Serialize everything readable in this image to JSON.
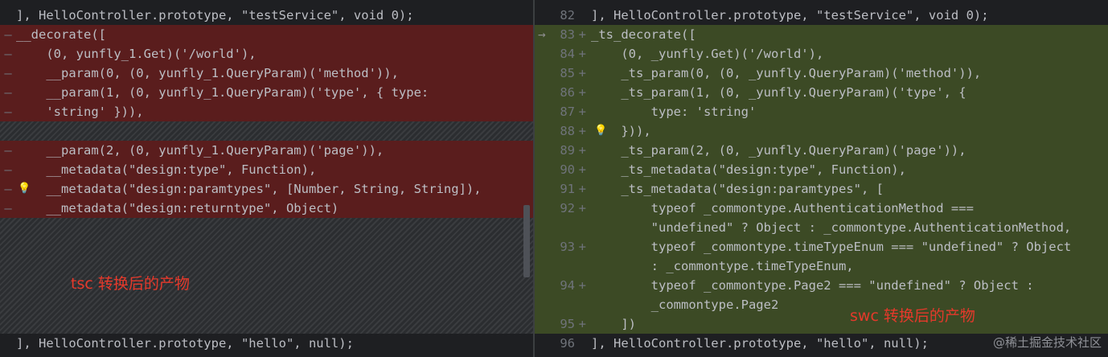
{
  "left": {
    "lines": [
      "], HelloController.prototype, \"testService\", void 0);",
      "__decorate([",
      "    (0, yunfly_1.Get)('/world'),",
      "    __param(0, (0, yunfly_1.QueryParam)('method')),",
      "    __param(1, (0, yunfly_1.QueryParam)('type', { type:",
      "    'string' })),",
      "    __param(2, (0, yunfly_1.QueryParam)('page')),",
      "    __metadata(\"design:type\", Function),",
      "    __metadata(\"design:paramtypes\", [Number, String, String]),",
      "    __metadata(\"design:returntype\", Object)",
      "], HelloController.prototype, \"hello\", null);"
    ],
    "annotation": "tsc 转换后的产物"
  },
  "right": {
    "lines": [
      {
        "no": "82",
        "mark": "",
        "text": "], HelloController.prototype, \"testService\", void 0);"
      },
      {
        "no": "83",
        "mark": "+",
        "text": "_ts_decorate(["
      },
      {
        "no": "84",
        "mark": "+",
        "text": "    (0, _yunfly.Get)('/world'),"
      },
      {
        "no": "85",
        "mark": "+",
        "text": "    _ts_param(0, (0, _yunfly.QueryParam)('method')),"
      },
      {
        "no": "86",
        "mark": "+",
        "text": "    _ts_param(1, (0, _yunfly.QueryParam)('type', {"
      },
      {
        "no": "87",
        "mark": "+",
        "text": "        type: 'string'"
      },
      {
        "no": "88",
        "mark": "+",
        "text": "    })),"
      },
      {
        "no": "89",
        "mark": "+",
        "text": "    _ts_param(2, (0, _yunfly.QueryParam)('page')),"
      },
      {
        "no": "90",
        "mark": "+",
        "text": "    _ts_metadata(\"design:type\", Function),"
      },
      {
        "no": "91",
        "mark": "+",
        "text": "    _ts_metadata(\"design:paramtypes\", ["
      },
      {
        "no": "92",
        "mark": "+",
        "text": "        typeof _commontype.AuthenticationMethod ==="
      },
      {
        "no": "",
        "mark": "",
        "text": "        \"undefined\" ? Object : _commontype.AuthenticationMethod,"
      },
      {
        "no": "93",
        "mark": "+",
        "text": "        typeof _commontype.timeTypeEnum === \"undefined\" ? Object"
      },
      {
        "no": "",
        "mark": "",
        "text": "        : _commontype.timeTypeEnum,"
      },
      {
        "no": "94",
        "mark": "+",
        "text": "        typeof _commontype.Page2 === \"undefined\" ? Object :"
      },
      {
        "no": "",
        "mark": "",
        "text": "        _commontype.Page2"
      },
      {
        "no": "95",
        "mark": "+",
        "text": "    ])"
      },
      {
        "no": "96",
        "mark": "",
        "text": "], HelloController.prototype, \"hello\", null);"
      }
    ],
    "annotation": "swc 转换后的产物"
  },
  "watermark": "@稀土掘金技术社区",
  "colors": {
    "deleted": "#5a1d1d",
    "added": "#3c4a25",
    "annotation": "#e5392b"
  }
}
